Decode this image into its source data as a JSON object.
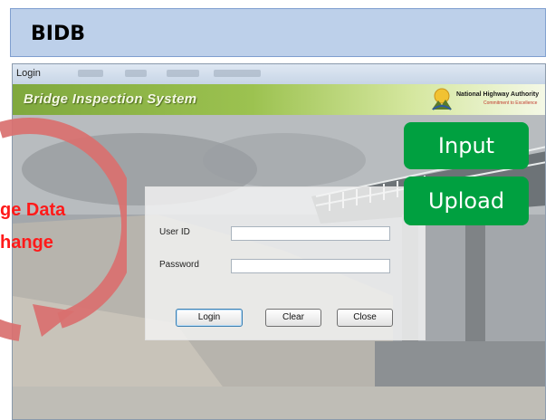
{
  "slide": {
    "heading": "BIDB"
  },
  "window": {
    "title": "Login",
    "app_title": "Bridge Inspection System",
    "org_name": "National Highway Authority",
    "org_tagline": "Commitment to Excellence"
  },
  "login_form": {
    "user_id_label": "User ID",
    "user_id_value": "",
    "password_label": "Password",
    "password_value": "",
    "login_button": "Login",
    "clear_button": "Clear",
    "close_button": "Close"
  },
  "actions": {
    "input_button": "Input",
    "upload_button": "Upload"
  },
  "overlay": {
    "line1": "ge Data",
    "line2": "hange"
  },
  "colors": {
    "action_green": "#00a040",
    "cycle_arrow": "#d9706f",
    "overlay_text": "#ff1a1a",
    "banner_green": "#8cb547"
  }
}
